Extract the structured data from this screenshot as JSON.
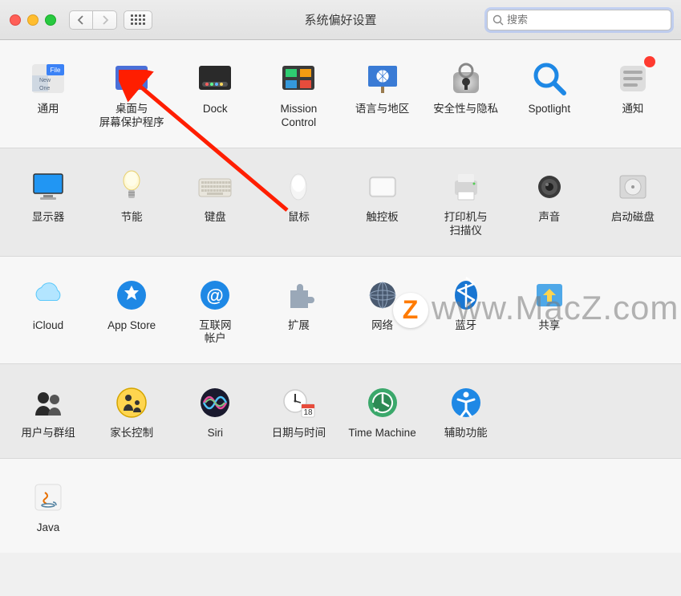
{
  "window": {
    "title": "系统偏好设置"
  },
  "search": {
    "placeholder": "搜索"
  },
  "rows": [
    {
      "items": [
        {
          "name": "general",
          "label": "通用",
          "icon": "general-icon"
        },
        {
          "name": "desktop",
          "label": "桌面与\n屏幕保护程序",
          "icon": "desktop-icon"
        },
        {
          "name": "dock",
          "label": "Dock",
          "icon": "dock-icon"
        },
        {
          "name": "mission-control",
          "label": "Mission\nControl",
          "icon": "mission-control-icon"
        },
        {
          "name": "language",
          "label": "语言与地区",
          "icon": "language-icon"
        },
        {
          "name": "security",
          "label": "安全性与隐私",
          "icon": "security-icon"
        },
        {
          "name": "spotlight",
          "label": "Spotlight",
          "icon": "spotlight-icon"
        },
        {
          "name": "notifications",
          "label": "通知",
          "icon": "notifications-icon",
          "badge": true
        }
      ]
    },
    {
      "items": [
        {
          "name": "displays",
          "label": "显示器",
          "icon": "displays-icon"
        },
        {
          "name": "energy",
          "label": "节能",
          "icon": "energy-icon"
        },
        {
          "name": "keyboard",
          "label": "键盘",
          "icon": "keyboard-icon"
        },
        {
          "name": "mouse",
          "label": "鼠标",
          "icon": "mouse-icon"
        },
        {
          "name": "trackpad",
          "label": "触控板",
          "icon": "trackpad-icon"
        },
        {
          "name": "printers",
          "label": "打印机与\n扫描仪",
          "icon": "printers-icon"
        },
        {
          "name": "sound",
          "label": "声音",
          "icon": "sound-icon"
        },
        {
          "name": "startup-disk",
          "label": "启动磁盘",
          "icon": "startup-disk-icon"
        }
      ]
    },
    {
      "items": [
        {
          "name": "icloud",
          "label": "iCloud",
          "icon": "icloud-icon"
        },
        {
          "name": "app-store",
          "label": "App Store",
          "icon": "app-store-icon"
        },
        {
          "name": "internet-accounts",
          "label": "互联网\n帐户",
          "icon": "internet-accounts-icon"
        },
        {
          "name": "extensions",
          "label": "扩展",
          "icon": "extensions-icon"
        },
        {
          "name": "network",
          "label": "网络",
          "icon": "network-icon"
        },
        {
          "name": "bluetooth",
          "label": "蓝牙",
          "icon": "bluetooth-icon"
        },
        {
          "name": "sharing",
          "label": "共享",
          "icon": "sharing-icon"
        }
      ]
    },
    {
      "items": [
        {
          "name": "users-groups",
          "label": "用户与群组",
          "icon": "users-groups-icon"
        },
        {
          "name": "parental-controls",
          "label": "家长控制",
          "icon": "parental-controls-icon"
        },
        {
          "name": "siri",
          "label": "Siri",
          "icon": "siri-icon"
        },
        {
          "name": "date-time",
          "label": "日期与时间",
          "icon": "date-time-icon"
        },
        {
          "name": "time-machine",
          "label": "Time Machine",
          "icon": "time-machine-icon"
        },
        {
          "name": "accessibility",
          "label": "辅助功能",
          "icon": "accessibility-icon"
        }
      ]
    },
    {
      "items": [
        {
          "name": "java",
          "label": "Java",
          "icon": "java-icon"
        }
      ]
    }
  ],
  "watermark": "www.MacZ.com"
}
